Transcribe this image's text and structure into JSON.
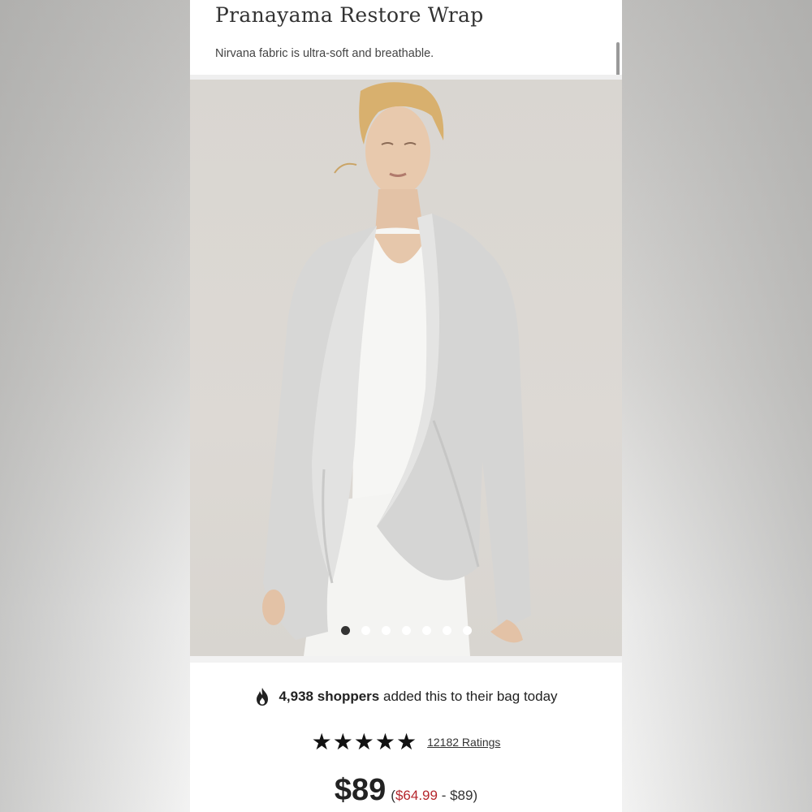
{
  "product": {
    "title": "Pranayama Restore Wrap",
    "subtitle": "Nirvana fabric is ultra-soft and breathable."
  },
  "gallery": {
    "image": "model-wearing-light-gray-wrap",
    "dot_count": 7,
    "active_index": 0
  },
  "social_proof": {
    "icon": "flame-icon",
    "count": "4,938 shoppers",
    "text": "added this to their bag today"
  },
  "rating": {
    "stars": "★★★★★",
    "count_label": "12182 Ratings"
  },
  "price": {
    "main": "$89",
    "open_paren": "(",
    "sale_low": "$64.99",
    "range_sep": " - $89)",
    "sale_color": "#b5262c"
  }
}
